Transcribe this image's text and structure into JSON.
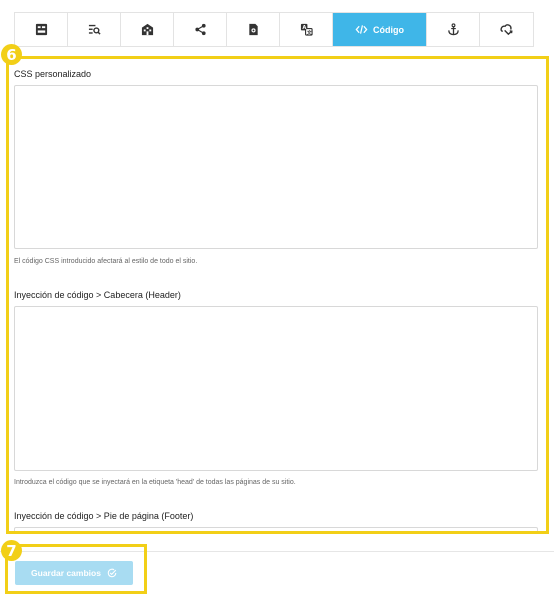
{
  "toolbar": {
    "tabs": [
      {
        "icon": "layout-icon"
      },
      {
        "icon": "seo-search-icon"
      },
      {
        "icon": "building-icon"
      },
      {
        "icon": "share-icon"
      },
      {
        "icon": "settings-file-icon"
      },
      {
        "icon": "translate-icon"
      },
      {
        "icon": "code-icon",
        "label": "Código",
        "active": true
      },
      {
        "icon": "anchor-icon"
      },
      {
        "icon": "cloud-arrow-icon"
      }
    ],
    "accent_color": "#3fb6e8"
  },
  "annotations": {
    "form_badge": "6",
    "save_badge": "7",
    "highlight_color": "#f2cf17"
  },
  "form": {
    "css": {
      "label": "CSS personalizado",
      "value": "",
      "help": "El código CSS introducido afectará al estilo de todo el sitio."
    },
    "header_code": {
      "label": "Inyección de código > Cabecera (Header)",
      "value": "",
      "help": "Introduzca el código que se inyectará en la etiqueta 'head' de todas las páginas de su sitio."
    },
    "footer_code": {
      "label": "Inyección de código > Pie de página (Footer)",
      "value": ""
    }
  },
  "footer": {
    "save_label": "Guardar cambios",
    "save_icon": "check-circle-icon",
    "save_color": "#a8dcf2"
  }
}
